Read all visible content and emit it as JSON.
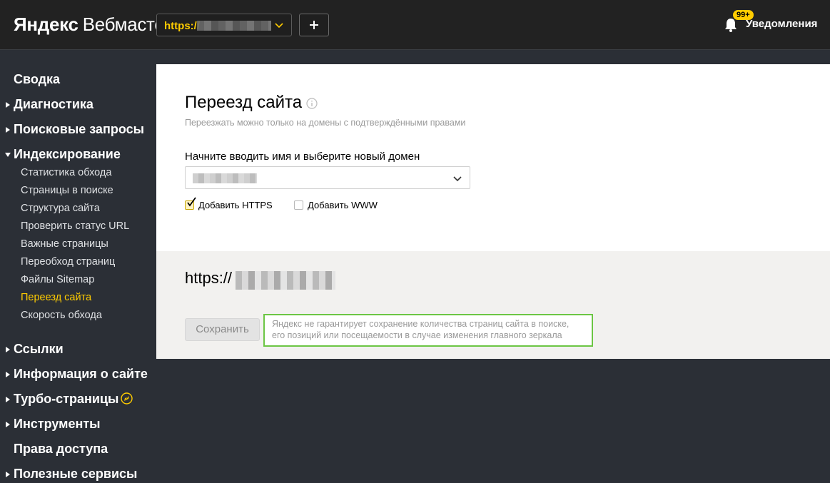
{
  "header": {
    "logo_brand": "Яндекс",
    "logo_product": "Вебмастер",
    "site_selector": {
      "url_prefix": "https://"
    },
    "add_button_label": "+",
    "notifications": {
      "badge": "99+",
      "label": "Уведомления"
    }
  },
  "sidebar": {
    "items": [
      {
        "label": "Сводка",
        "arrow": "none"
      },
      {
        "label": "Диагностика",
        "arrow": "right"
      },
      {
        "label": "Поисковые запросы",
        "arrow": "right"
      },
      {
        "label": "Индексирование",
        "arrow": "down"
      },
      {
        "label": "Ссылки",
        "arrow": "right"
      },
      {
        "label": "Информация о сайте",
        "arrow": "right"
      },
      {
        "label": "Турбо-страницы",
        "arrow": "right",
        "icon": "rocket-icon"
      },
      {
        "label": "Инструменты",
        "arrow": "right"
      },
      {
        "label": "Права доступа",
        "arrow": "none"
      },
      {
        "label": "Полезные сервисы",
        "arrow": "right"
      }
    ],
    "indexing_sub": [
      {
        "label": "Статистика обхода"
      },
      {
        "label": "Страницы в поиске"
      },
      {
        "label": "Структура сайта"
      },
      {
        "label": "Проверить статус URL"
      },
      {
        "label": "Важные страницы"
      },
      {
        "label": "Переобход страниц"
      },
      {
        "label": "Файлы Sitemap"
      },
      {
        "label": "Переезд сайта",
        "active": true
      },
      {
        "label": "Скорость обхода"
      }
    ]
  },
  "main": {
    "title": "Переезд сайта",
    "subtitle": "Переезжать можно только на домены с подтверждёнными правами",
    "field_label": "Начните вводить имя и выберите новый домен",
    "checkbox_https": {
      "label": "Добавить HTTPS",
      "checked": true
    },
    "checkbox_www": {
      "label": "Добавить WWW",
      "checked": false
    },
    "current_url_prefix": "https://",
    "save_label": "Сохранить",
    "warning": "Яндекс не гарантирует сохранение количества страниц сайта в поиске, его позиций или посещаемости в случае изменения главного зеркала"
  },
  "colors": {
    "accent": "#ffcc00",
    "header_bg": "#222222",
    "sidebar_bg": "#2b2f36",
    "highlight_border": "#6cc644"
  }
}
